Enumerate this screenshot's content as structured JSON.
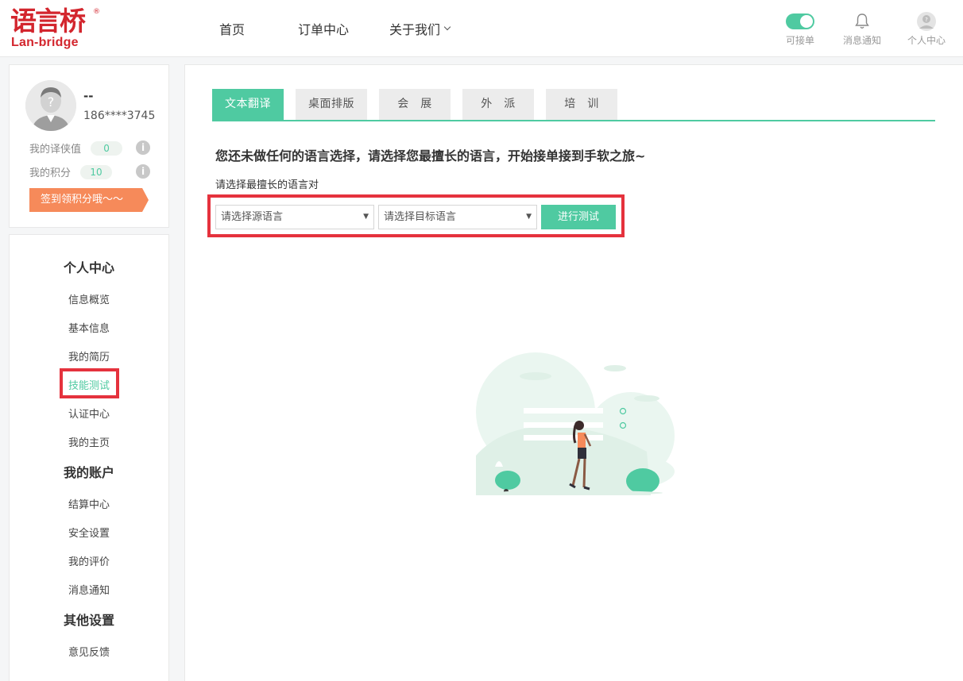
{
  "header": {
    "logo_cn": "语言桥",
    "logo_en": "Lan-bridge",
    "logo_reg": "®",
    "nav": {
      "home": "首页",
      "orders": "订单中心",
      "about": "关于我们"
    },
    "toggle_label": "可接单",
    "toggle_on": true,
    "notify_label": "消息通知",
    "user_label": "个人中心"
  },
  "profile": {
    "name": "--",
    "phone": "186****3745",
    "credit_label": "我的译侠值",
    "credit_value": "0",
    "points_label": "我的积分",
    "points_value": "10",
    "info_glyph": "i",
    "signin_label": "签到领积分哦～～"
  },
  "menu": {
    "section1": "个人中心",
    "items1": [
      "信息概览",
      "基本信息",
      "我的简历",
      "技能测试",
      "认证中心",
      "我的主页"
    ],
    "section2": "我的账户",
    "items2": [
      "结算中心",
      "安全设置",
      "我的评价",
      "消息通知"
    ],
    "section3": "其他设置",
    "items3": [
      "意见反馈"
    ]
  },
  "tabs": [
    "文本翻译",
    "桌面排版",
    "会　展",
    "外　派",
    "培　训"
  ],
  "main": {
    "notice": "您还未做任何的语言选择，请选择您最擅长的语言，开始接单接到手软之旅~",
    "pair_label": "请选择最擅长的语言对",
    "source_placeholder": "请选择源语言",
    "target_placeholder": "请选择目标语言",
    "test_button": "进行测试"
  },
  "colors": {
    "accent": "#4fcaa1",
    "brand": "#d3262e",
    "highlight": "#e5323d",
    "signin": "#f68a5a"
  }
}
